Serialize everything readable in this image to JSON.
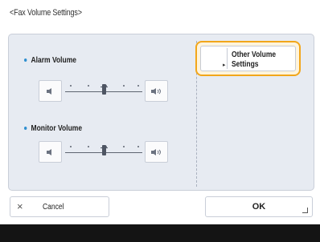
{
  "title": "<Fax Volume Settings>",
  "alarm": {
    "label": "Alarm Volume",
    "level": 2,
    "max": 4
  },
  "monitor": {
    "label": "Monitor Volume",
    "level": 2,
    "max": 4
  },
  "other_settings": {
    "label_line1": "Other Volume",
    "label_line2": "Settings"
  },
  "cancel": {
    "label": "Cancel"
  },
  "ok": {
    "label": "OK"
  },
  "colors": {
    "panel": "#e7ebf2",
    "highlight": "#f2a61a",
    "bullet": "#2f8fd0"
  },
  "icons": {
    "decrease": "speaker-low-icon",
    "increase": "speaker-high-icon",
    "cancel": "close-icon"
  }
}
